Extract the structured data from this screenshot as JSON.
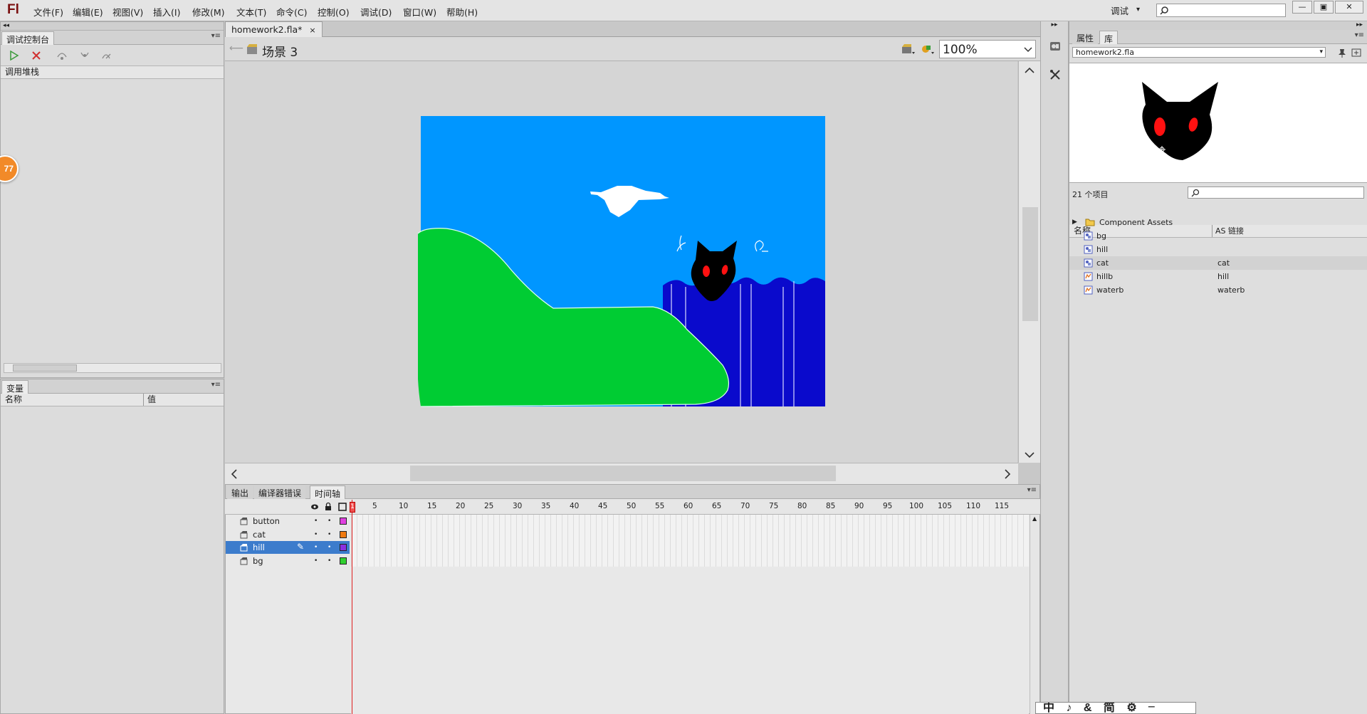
{
  "app": {
    "logo": "Fl"
  },
  "menu": [
    "文件(F)",
    "编辑(E)",
    "视图(V)",
    "插入(I)",
    "修改(M)",
    "文本(T)",
    "命令(C)",
    "控制(O)",
    "调试(D)",
    "窗口(W)",
    "帮助(H)"
  ],
  "workspace": {
    "label": "调试",
    "caret": "▾"
  },
  "window_controls": [
    "—",
    "▣",
    "✕"
  ],
  "debug_console": {
    "tab": "调试控制台",
    "stack_header": "调用堆栈",
    "badge": "77"
  },
  "variables": {
    "tab": "变量",
    "col_name": "名称",
    "col_value": "值"
  },
  "document": {
    "tab": "homework2.fla*",
    "close": "×",
    "scene": "场景 3",
    "zoom": "100%"
  },
  "bottom_tabs": [
    "输出",
    "编译器错误",
    "时间轴"
  ],
  "timeline": {
    "frame_numbers": [
      "5",
      "10",
      "15",
      "20",
      "25",
      "30",
      "35",
      "40",
      "45",
      "50",
      "55",
      "60",
      "65",
      "70",
      "75",
      "80",
      "85",
      "90",
      "95",
      "100",
      "105",
      "110",
      "115"
    ],
    "playhead_frame": "1",
    "layers": [
      {
        "name": "button",
        "color": "#e040e0",
        "selected": false
      },
      {
        "name": "cat",
        "color": "#f07a10",
        "selected": false
      },
      {
        "name": "hill",
        "color": "#8a30e0",
        "selected": true
      },
      {
        "name": "bg",
        "color": "#30d030",
        "selected": false
      }
    ]
  },
  "right_panel": {
    "tabs": [
      "属性",
      "库"
    ],
    "library_file": "homework2.fla",
    "item_count": "21 个项目",
    "col_name": "名称",
    "col_linkage": "AS 链接",
    "items": [
      {
        "name": "Component Assets",
        "linkage": "",
        "type": "folder"
      },
      {
        "name": "bg",
        "linkage": "",
        "type": "graphic"
      },
      {
        "name": "hill",
        "linkage": "",
        "type": "graphic"
      },
      {
        "name": "cat",
        "linkage": "cat",
        "type": "graphic"
      },
      {
        "name": "hillb",
        "linkage": "hill",
        "type": "movieclip"
      },
      {
        "name": "waterb",
        "linkage": "waterb",
        "type": "movieclip"
      }
    ]
  },
  "ime_bar": {
    "glyphs": "中 ♪ & 简 ⚙ ╴"
  },
  "colors": {
    "sky": "#0096ff",
    "hill": "#00cc33",
    "water": "#0a0acc",
    "cat": "#000000",
    "eyes": "#ff1111",
    "selection": "#3c7ccc"
  }
}
